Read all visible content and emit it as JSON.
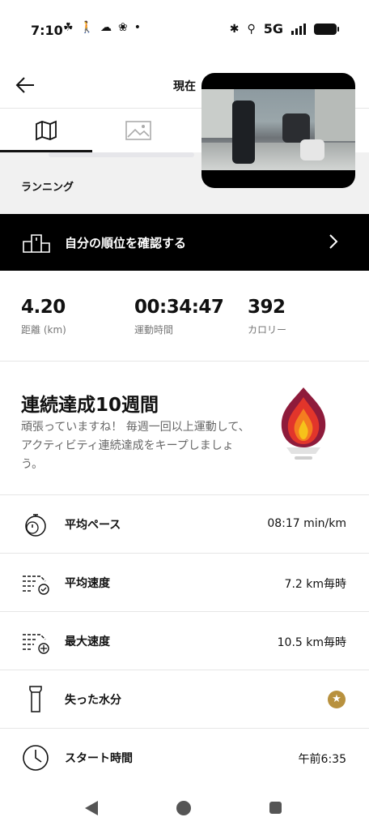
{
  "status_bar": {
    "time": "7:10",
    "network": "5G"
  },
  "header": {
    "title": "現在"
  },
  "tabs": [
    {
      "icon": "map-icon",
      "active": true
    },
    {
      "icon": "image-icon",
      "active": false
    }
  ],
  "activity": {
    "type": "ランニング"
  },
  "ranking": {
    "label": "自分の順位を確認する"
  },
  "stats": [
    {
      "value": "4.20",
      "label": "距離 (km)"
    },
    {
      "value": "00:34:47",
      "label": "運動時間"
    },
    {
      "value": "392",
      "label": "カロリー"
    }
  ],
  "streak": {
    "title": "連続達成10週間",
    "description": "頑張っていますね！ 毎週一回以上運動して、アクティビティ連続達成をキープしましょう。"
  },
  "metrics": [
    {
      "label": "平均ペース",
      "value": "08:17 min/km",
      "icon": "pace-stopwatch-icon"
    },
    {
      "label": "平均速度",
      "value": "7.2 km毎時",
      "icon": "avg-speed-icon"
    },
    {
      "label": "最大速度",
      "value": "10.5 km毎時",
      "icon": "max-speed-icon"
    },
    {
      "label": "失った水分",
      "value": "",
      "icon": "bottle-icon",
      "badge": "★"
    },
    {
      "label": "スタート時間",
      "value": "午前6:35",
      "icon": "clock-icon"
    }
  ],
  "colors": {
    "rank_bg": "#000000",
    "badge": "#b8913e",
    "flame_outer": "#8e1b3b",
    "flame_mid": "#e2352b",
    "flame_inner": "#f6a51a"
  }
}
